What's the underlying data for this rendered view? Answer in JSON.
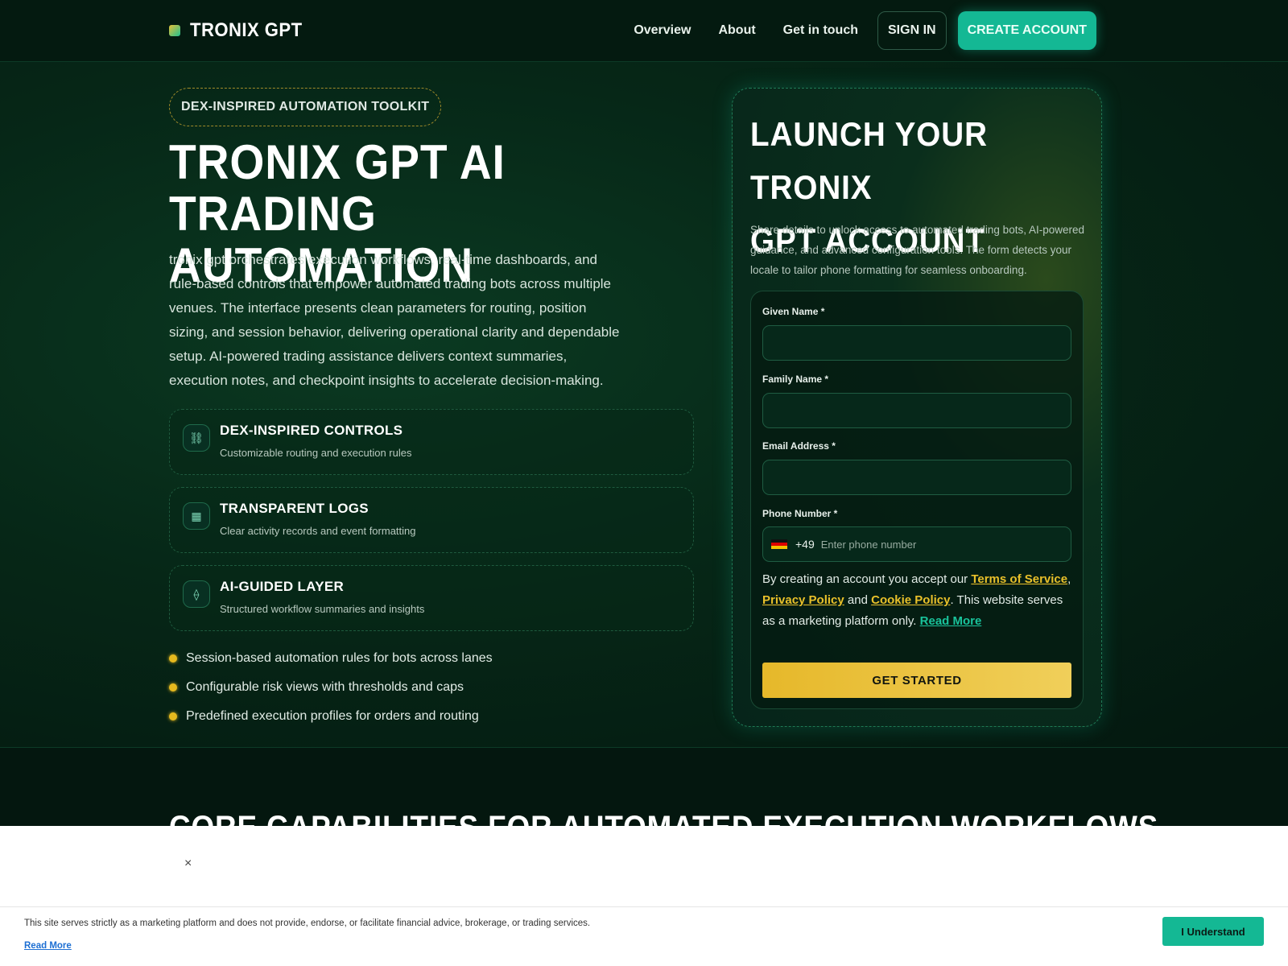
{
  "header": {
    "logo_text": "TRONIX GPT",
    "nav": [
      "Overview",
      "About",
      "Get in touch"
    ],
    "sign_in": "SIGN IN",
    "create_account": "CREATE ACCOUNT"
  },
  "hero": {
    "pill": "DEX-INSPIRED AUTOMATION TOOLKIT",
    "title_line1": "TRONIX GPT AI TRADING",
    "title_line2": "AUTOMATION",
    "description": "tronix gpt orchestrates execution workflows, real-time dashboards, and rule-based controls that empower automated trading bots across multiple venues. The interface presents clean parameters for routing, position sizing, and session behavior, delivering operational clarity and dependable setup. AI-powered trading assistance delivers context summaries, execution notes, and checkpoint insights to accelerate decision-making.",
    "features": [
      {
        "icon": "link-icon",
        "glyph": "⛓",
        "title": "DEX-INSPIRED CONTROLS",
        "subtitle": "Customizable routing and execution rules"
      },
      {
        "icon": "grid-icon",
        "glyph": "▦",
        "title": "TRANSPARENT LOGS",
        "subtitle": "Clear activity records and event formatting"
      },
      {
        "icon": "diamond-icon",
        "glyph": "⟠",
        "title": "AI-GUIDED LAYER",
        "subtitle": "Structured workflow summaries and insights"
      }
    ],
    "bullets": [
      "Session-based automation rules for bots across lanes",
      "Configurable risk views with thresholds and caps",
      "Predefined execution profiles for orders and routing"
    ]
  },
  "form_card": {
    "title_line1": "LAUNCH YOUR TRONIX",
    "title_line2": "GPT ACCOUNT",
    "description": "Share details to unlock access to automated trading bots, AI-powered guidance, and advanced configuration tools. The form detects your locale to tailor phone formatting for seamless onboarding.",
    "given_name_label": "Given Name *",
    "family_name_label": "Family Name *",
    "email_label": "Email Address *",
    "phone_label": "Phone Number *",
    "phone_code": "+49",
    "phone_placeholder": "Enter phone number",
    "consent_prefix": "By creating an account you accept our ",
    "terms": "Terms of Service",
    "comma": ",",
    "privacy": "Privacy Policy",
    "and": " and ",
    "cookie_policy": "Cookie Policy",
    "consent_suffix": ". This website serves as a marketing platform only. ",
    "read_more": "Read More",
    "submit": "GET STARTED"
  },
  "section2": {
    "title": "CORE CAPABILITIES FOR AUTOMATED EXECUTION WORKFLOWS"
  },
  "banner": {
    "close": "×"
  },
  "cookie": {
    "text": "This site serves strictly as a marketing platform and does not provide, endorse, or facilitate financial advice, brokerage, or trading services.",
    "read_more": "Read More",
    "button": "I Understand"
  },
  "colors": {
    "accent_teal": "#14b894",
    "accent_gold": "#e9c02a",
    "background": "#04170f"
  }
}
